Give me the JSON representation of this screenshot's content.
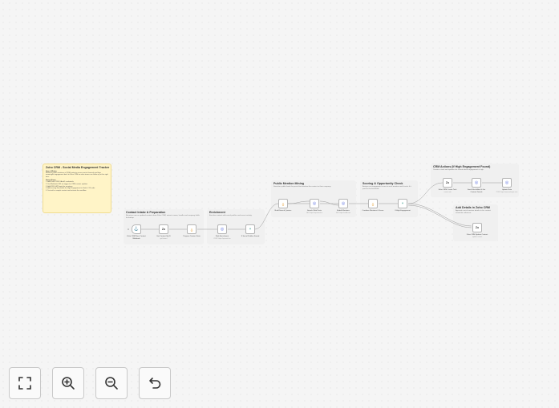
{
  "intro": {
    "title": "Zoho CRM - Social Media Engagement Tracker",
    "heading_1": "How it Works",
    "body": "Monitors public mentions of CRM contacts across social channels and logs meaningful engagement back to Zoho CRM so sales teams can follow up at the right time.",
    "heading_2": "Setup Steps",
    "steps": [
      "1. Add Zoho CRM OAuth2 credentials",
      "2. Set Webhook URL as trigger for CRM contact updates",
      "3. Add RSS / API feeds for mentions",
      "4. Add scoring thresholds for High Engagement in Switch / IF node",
      "5. Test with a sample contact and activate the workflow"
    ]
  },
  "groups": [
    {
      "title": "Contact Intake & Preparation",
      "desc": "Receives new or updated contacts from Zoho CRM, extracts name, handle and company fields for lookup."
    },
    {
      "title": "Enrichment",
      "desc": "Enriches contact with social profiles and recent activity."
    },
    {
      "title": "Public Mention Mining",
      "desc": "Searches public feeds for posts that mention the contact or their company."
    },
    {
      "title": "Scoring & Opportunity Check",
      "desc": "Assigns an engagement score to each mention and checks if it passes the threshold."
    },
    {
      "title": "CRM Actions (If High Engagement Found)",
      "desc": "Creates a task and updates the record when engagement is high."
    },
    {
      "title": "Add Details in Zoho CRM",
      "desc": "Appends social mention details to the contact record for reference."
    }
  ],
  "nodes": [
    {
      "label": "Zoho CRM New Contact Webhook",
      "sub": "",
      "icon": "webhook-icon",
      "glyph": "⚓",
      "color": "#555555"
    },
    {
      "label": "Get Contact By ID",
      "sub": "getContact",
      "icon": "zoho-icon",
      "glyph": "Zo",
      "color": "#444444"
    },
    {
      "label": "Prepare Contact Data",
      "sub": "",
      "icon": "code-icon",
      "glyph": "{}",
      "color": "#e8a33a"
    },
    {
      "label": "Web Enrichment",
      "sub": "POST: https://api.enrich.io",
      "icon": "globe-icon",
      "glyph": "◎",
      "color": "#5b6ee1"
    },
    {
      "label": "If Social Profiles Found",
      "sub": "",
      "icon": "if-icon",
      "glyph": "⑂",
      "color": "#3a9e8f"
    },
    {
      "label": "Build Search Queries",
      "sub": "",
      "icon": "code-icon",
      "glyph": "{}",
      "color": "#e8a33a"
    },
    {
      "label": "Search Web Posts",
      "sub": "GET: https://api.search.io",
      "icon": "globe-icon",
      "glyph": "◎",
      "color": "#5b6ee1"
    },
    {
      "label": "Reddit Mentions",
      "sub": "GET: https://reddit.com",
      "icon": "globe-icon",
      "glyph": "◎",
      "color": "#5b6ee1"
    },
    {
      "label": "Combine Mentions & Score",
      "sub": "",
      "icon": "code-icon",
      "glyph": "{}",
      "color": "#e8a33a"
    },
    {
      "label": "If High Engagement",
      "sub": "",
      "icon": "if-icon",
      "glyph": "⑂",
      "color": "#3a9e8f"
    },
    {
      "label": "Zoho CRM Create Task",
      "sub": "create: task",
      "icon": "zoho-icon",
      "glyph": "Zo",
      "color": "#444444"
    },
    {
      "label": "Send Slack Alert & Get Contact Details",
      "sub": "",
      "icon": "globe-icon",
      "glyph": "◎",
      "color": "#5b6ee1"
    },
    {
      "label": "Update Note",
      "sub": "POST: https://www.zohoapis.com",
      "icon": "globe-icon",
      "glyph": "◎",
      "color": "#5b6ee1"
    },
    {
      "label": "Zoho CRM Update Contact",
      "sub": "update: contact",
      "icon": "zoho-icon",
      "glyph": "Zo",
      "color": "#444444"
    }
  ],
  "controls": [
    {
      "name": "fit-view-button",
      "icon": "fit-view-icon"
    },
    {
      "name": "zoom-in-button",
      "icon": "zoom-in-icon"
    },
    {
      "name": "zoom-out-button",
      "icon": "zoom-out-icon"
    },
    {
      "name": "reset-zoom-button",
      "icon": "undo-icon"
    }
  ],
  "colors": {
    "canvas_bg": "#f5f5f5",
    "intro_note": "#fff4c7",
    "group_note": "#f0f0f0",
    "edge": "#9a9a9a"
  }
}
